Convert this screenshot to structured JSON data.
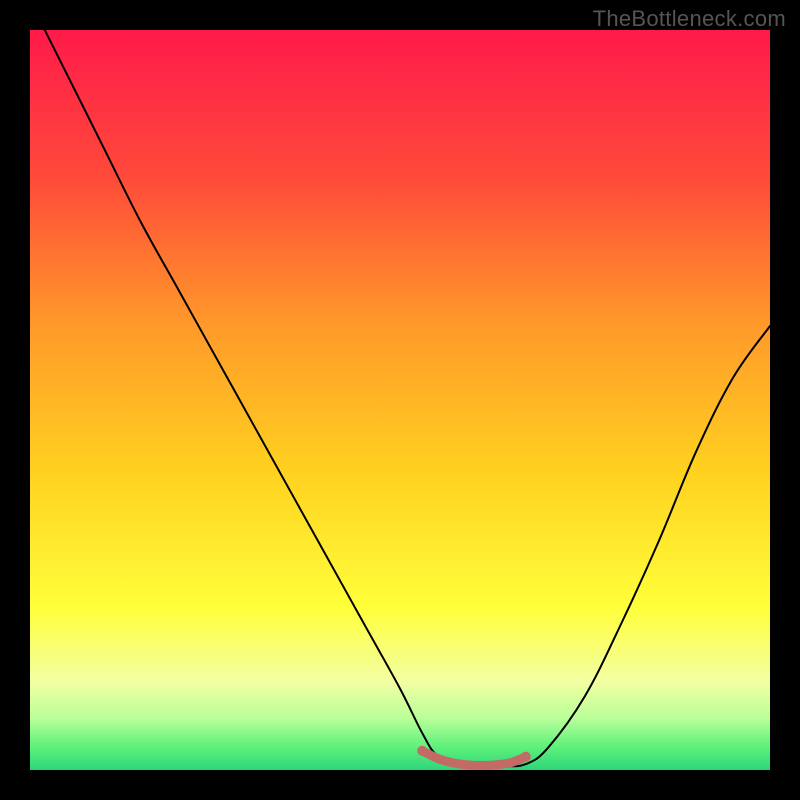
{
  "watermark": "TheBottleneck.com",
  "chart_data": {
    "type": "line",
    "title": "",
    "xlabel": "",
    "ylabel": "",
    "xlim": [
      0,
      100
    ],
    "ylim": [
      0,
      100
    ],
    "background_gradient": {
      "stops": [
        {
          "offset": 0.0,
          "color": "#ff1a4a"
        },
        {
          "offset": 0.2,
          "color": "#ff4a3a"
        },
        {
          "offset": 0.4,
          "color": "#ff9a2a"
        },
        {
          "offset": 0.6,
          "color": "#ffd21f"
        },
        {
          "offset": 0.78,
          "color": "#ffff3a"
        },
        {
          "offset": 0.88,
          "color": "#f3ffa2"
        },
        {
          "offset": 0.93,
          "color": "#b9ff9a"
        },
        {
          "offset": 0.97,
          "color": "#5cf07a"
        },
        {
          "offset": 1.0,
          "color": "#2cd67a"
        }
      ]
    },
    "series": [
      {
        "name": "bottleneck-curve",
        "stroke": "#000000",
        "stroke_width": 2,
        "x": [
          2,
          6,
          10,
          15,
          20,
          25,
          30,
          35,
          40,
          45,
          50,
          53,
          55,
          58,
          61,
          64,
          67,
          70,
          75,
          80,
          85,
          90,
          95,
          100
        ],
        "y": [
          100,
          92,
          84,
          74,
          65,
          56,
          47,
          38,
          29,
          20,
          11,
          5,
          2,
          0.8,
          0.5,
          0.5,
          0.8,
          3,
          10,
          20,
          31,
          43,
          53,
          60
        ]
      },
      {
        "name": "optimal-band",
        "stroke": "#c46a66",
        "stroke_width": 9,
        "x": [
          53,
          55,
          57,
          59,
          61,
          63,
          65,
          67
        ],
        "y": [
          2.6,
          1.6,
          1.0,
          0.7,
          0.6,
          0.7,
          1.0,
          1.8
        ]
      }
    ],
    "endpoints": [
      {
        "name": "left-endpoint",
        "x": 53,
        "y": 2.6,
        "color": "#c46a66",
        "r": 5
      },
      {
        "name": "right-endpoint",
        "x": 67,
        "y": 1.8,
        "color": "#c46a66",
        "r": 5
      }
    ]
  }
}
